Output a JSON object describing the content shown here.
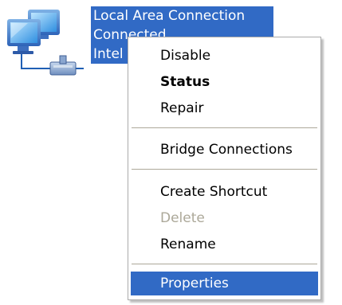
{
  "connection": {
    "name": "Local Area Connection",
    "status": "Connected",
    "device": "Intel",
    "icon": "network-connection-icon"
  },
  "menu": {
    "disable": "Disable",
    "status": "Status",
    "repair": "Repair",
    "bridge": "Bridge Connections",
    "create_shortcut": "Create Shortcut",
    "delete": "Delete",
    "rename": "Rename",
    "properties": "Properties"
  },
  "colors": {
    "selection": "#316ac5",
    "disabled_text": "#aca899",
    "menu_border": "#ababab"
  }
}
